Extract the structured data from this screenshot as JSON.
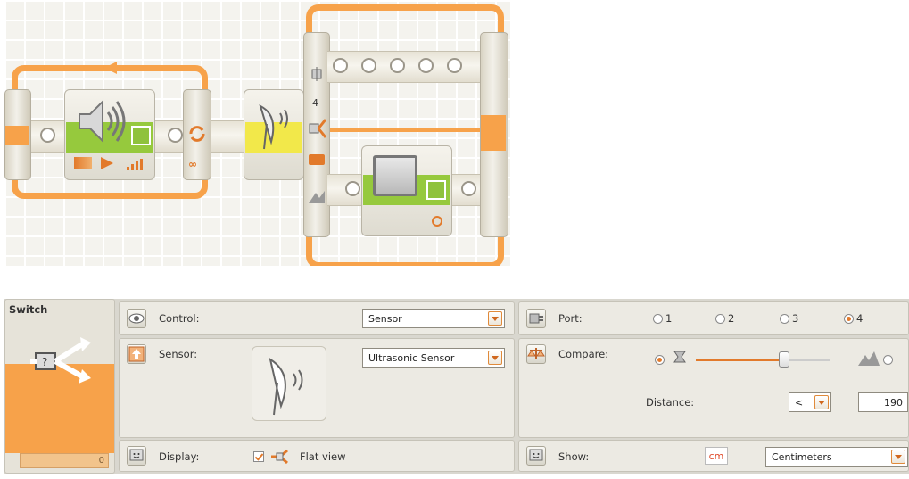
{
  "program": {
    "sensor_port_label": "4"
  },
  "panel": {
    "block_name": "Switch",
    "counter_value": "0",
    "control": {
      "label": "Control:",
      "value": "Sensor"
    },
    "sensor": {
      "label": "Sensor:",
      "value": "Ultrasonic Sensor"
    },
    "display": {
      "label": "Display:",
      "flat_view_label": "Flat view",
      "flat_view_checked": true
    },
    "port": {
      "label": "Port:",
      "options": [
        "1",
        "2",
        "3",
        "4"
      ],
      "selected": "4"
    },
    "compare": {
      "label": "Compare:",
      "slider_fraction": 0.66,
      "distance_label": "Distance:",
      "operator": "<",
      "distance_value": "190"
    },
    "show": {
      "label": "Show:",
      "unit_badge": "cm",
      "value": "Centimeters"
    }
  },
  "colors": {
    "accent": "#f7a24a",
    "green": "#96c93d",
    "yellow": "#f2e84a",
    "panel_bg": "#eceae3"
  }
}
